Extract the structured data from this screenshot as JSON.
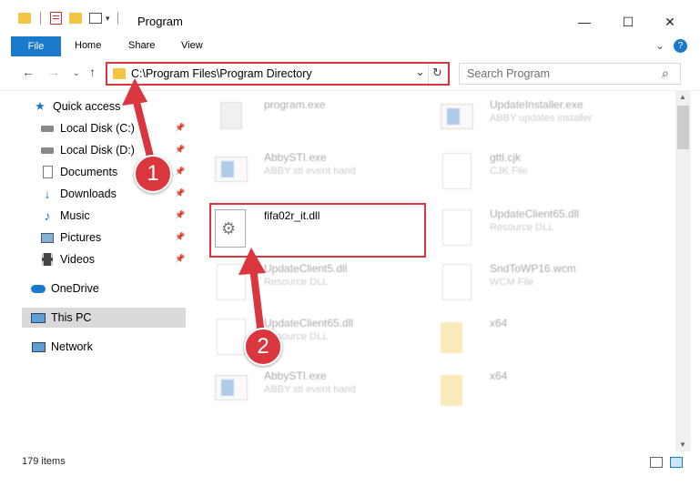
{
  "window": {
    "title": "Program",
    "minimize_glyph": "—",
    "maximize_glyph": "☐",
    "close_glyph": "✕"
  },
  "ribbon": {
    "tabs": [
      "File",
      "Home",
      "Share",
      "View"
    ],
    "expand_glyph": "⌄",
    "help_glyph": "?"
  },
  "address": {
    "path": "C:\\Program Files\\Program Directory",
    "dropdown_glyph": "⌄",
    "refresh_glyph": "↻"
  },
  "search": {
    "placeholder": "Search Program",
    "icon_glyph": "⌕"
  },
  "nav_pane": {
    "quick_access": "Quick access",
    "items": [
      {
        "label": "Local Disk (C:)",
        "icon": "drive-icon"
      },
      {
        "label": "Local Disk (D:)",
        "icon": "drive-icon"
      },
      {
        "label": "Documents",
        "icon": "documents-icon"
      },
      {
        "label": "Downloads",
        "icon": "downloads-icon"
      },
      {
        "label": "Music",
        "icon": "music-icon"
      },
      {
        "label": "Pictures",
        "icon": "pictures-icon"
      },
      {
        "label": "Videos",
        "icon": "videos-icon"
      }
    ],
    "onedrive": "OneDrive",
    "this_pc": "This PC",
    "network": "Network"
  },
  "files": {
    "left": [
      {
        "name": "program.exe",
        "desc": "",
        "icon": "exe-icon"
      },
      {
        "name": "AbbySTI.exe",
        "desc": "ABBY sti event hand",
        "icon": "app-icon"
      },
      {
        "name": "fifa02r_it.dll",
        "desc": "",
        "icon": "dll-icon"
      },
      {
        "name": "UpdateClient5.dll",
        "desc": "Resource DLL",
        "icon": "dll-icon"
      },
      {
        "name": "UpdateClient65.dll",
        "desc": "Resource DLL",
        "icon": "dll-icon"
      },
      {
        "name": "AbbySTI.exe",
        "desc": "ABBY sti event hand",
        "icon": "app-icon"
      }
    ],
    "right": [
      {
        "name": "UpdateInstaller.exe",
        "desc": "ABBY updates installer",
        "icon": "app-icon"
      },
      {
        "name": "gttl.cjk",
        "desc": "CJK File",
        "icon": "file-icon"
      },
      {
        "name": "UpdateClient65.dll",
        "desc": "Resource DLL",
        "icon": "dll-icon"
      },
      {
        "name": "SndToWP16.wcm",
        "desc": "WCM File",
        "icon": "file-icon"
      },
      {
        "name": "x64",
        "desc": "",
        "icon": "folder-icon"
      },
      {
        "name": "x64",
        "desc": "",
        "icon": "folder-icon"
      }
    ]
  },
  "status": {
    "item_count": "179 items"
  },
  "annotations": {
    "step1": "1",
    "step2": "2",
    "color": "#d9363e"
  },
  "colors": {
    "accent": "#1979ca",
    "highlight": "#d9363e",
    "selected_bg": "#d9d9d9"
  }
}
